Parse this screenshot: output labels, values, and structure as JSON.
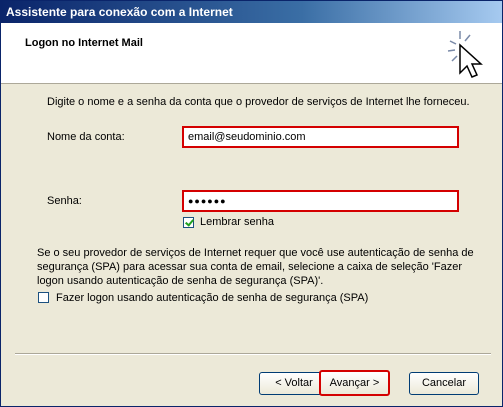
{
  "window": {
    "title": "Assistente para conexão com a Internet"
  },
  "header": {
    "title": "Logon no Internet Mail",
    "icon": "wizard-sparkle-cursor-icon"
  },
  "intro": "Digite o nome e a senha da conta que o provedor de serviços de Internet lhe forneceu.",
  "account": {
    "label": "Nome da conta:",
    "value": "email@seudominio.com"
  },
  "password": {
    "label": "Senha:",
    "value": "●●●●●●"
  },
  "remember": {
    "label": "Lembrar senha",
    "checked": true
  },
  "spa": {
    "text": "Se o seu provedor de serviços de Internet requer que você use autenticação de senha de segurança (SPA) para acessar sua conta de email, selecione a caixa de seleção 'Fazer logon usando autenticação de senha de segurança (SPA)'.",
    "checkbox_label": "Fazer logon usando autenticação de senha de segurança (SPA)",
    "checked": false
  },
  "buttons": {
    "back": "< Voltar",
    "next": "Avançar >",
    "cancel": "Cancelar"
  },
  "colors": {
    "highlight": "#d40000",
    "title_bar": "#0a246a",
    "dialog_bg": "#ece9d8"
  }
}
